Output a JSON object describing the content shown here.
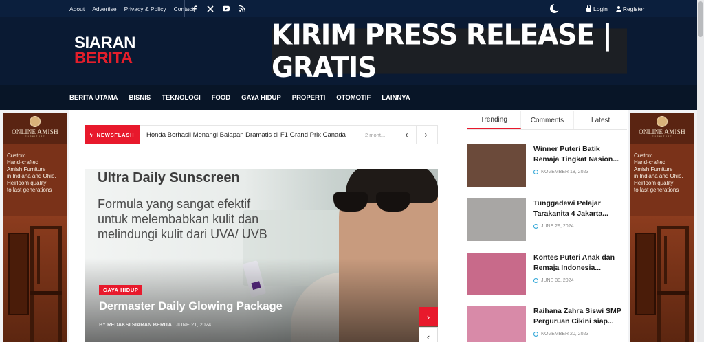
{
  "topbar": {
    "links": [
      "About",
      "Advertise",
      "Privacy & Policy",
      "Contact"
    ],
    "social_icons": [
      "facebook-icon",
      "x-icon",
      "youtube-icon",
      "rss-icon"
    ],
    "login": "Login",
    "register": "Register"
  },
  "header": {
    "logo_line1": "SIARAN",
    "logo_line2": "BERITA",
    "banner_text": "KIRIM PRESS RELEASE | GRATIS"
  },
  "nav": {
    "items": [
      "BERITA UTAMA",
      "BISNIS",
      "TEKNOLOGI",
      "FOOD",
      "GAYA HIDUP",
      "PROPERTI",
      "OTOMOTIF",
      "LAINNYA"
    ]
  },
  "ads": {
    "brand": "ONLINE AMISH",
    "brand_sub": "FURNITURE",
    "copy": [
      "Custom",
      "Hand-crafted",
      "Amish Furniture",
      "in Indiana and Ohio.",
      "Heirloom quality",
      "to last generations"
    ]
  },
  "newsflash": {
    "label": "NEWSFLASH",
    "headline": "Honda Berhasil Menangi Balapan Dramatis di F1 Grand Prix Canada",
    "time": "2 mont..."
  },
  "hero": {
    "image_heading": "Ultra Daily Sunscreen",
    "image_text": "Formula yang sangat efektif untuk melembabkan kulit dan melindungi kulit dari UVA/ UVB",
    "category": "GAYA HIDUP",
    "title": "Dermaster Daily Glowing Package",
    "author_prefix": "BY",
    "author": "REDAKSI SIARAN BERITA",
    "date": "JUNE 21, 2024"
  },
  "sidebar": {
    "tabs": [
      "Trending",
      "Comments",
      "Latest"
    ],
    "active_tab": "Trending",
    "items": [
      {
        "line1": "Winner Puteri Batik",
        "line2": "Remaja Tingkat Nasion...",
        "date": "NOVEMBER 18, 2023",
        "thumb_color": "#6b4a3a"
      },
      {
        "line1": "Tunggadewi Pelajar",
        "line2": "Tarakanita 4 Jakarta...",
        "date": "JUNE 29, 2024",
        "thumb_color": "#a8a6a4"
      },
      {
        "line1": "Kontes Puteri Anak dan",
        "line2": "Remaja Indonesia...",
        "date": "JUNE 30, 2024",
        "thumb_color": "#c86a8a"
      },
      {
        "line1": "Raihana Zahra Siswi SMP",
        "line2": "Perguruan Cikini siap...",
        "date": "NOVEMBER 20, 2023",
        "thumb_color": "#d88aa8"
      }
    ]
  },
  "colors": {
    "accent": "#e8192c",
    "topbar": "#0b1f3d",
    "header": "#0a1a33"
  }
}
